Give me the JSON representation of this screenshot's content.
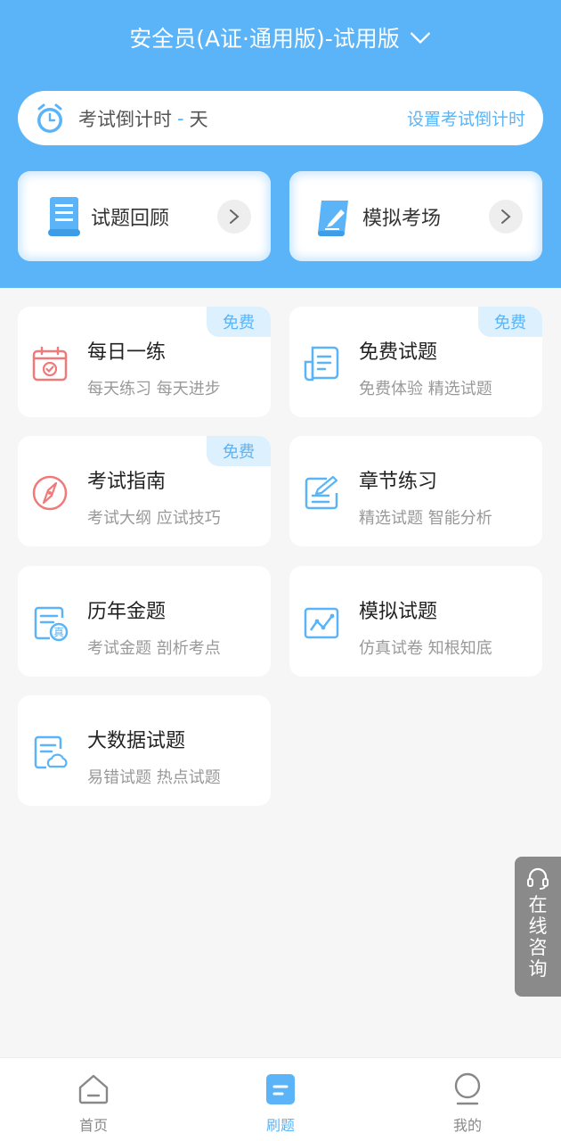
{
  "header": {
    "title": "安全员(A证·通用版)-试用版",
    "title_icon": "chevron-down-icon"
  },
  "countdown": {
    "label": "考试倒计时",
    "dash": "-",
    "value": "天",
    "link": "设置考试倒计时",
    "icon": "alarm-clock-icon"
  },
  "quick": [
    {
      "label": "试题回顾",
      "icon": "scroll-icon"
    },
    {
      "label": "模拟考场",
      "icon": "pen-paper-icon"
    }
  ],
  "cards": [
    {
      "title": "每日一练",
      "sub": "每天练习 每天进步",
      "badge": "免费",
      "icon": "calendar-check-icon"
    },
    {
      "title": "免费试题",
      "sub": "免费体验 精选试题",
      "badge": "免费",
      "icon": "document-icon"
    },
    {
      "title": "考试指南",
      "sub": "考试大纲 应试技巧",
      "badge": "免费",
      "icon": "compass-icon"
    },
    {
      "title": "章节练习",
      "sub": "精选试题 智能分析",
      "badge": "",
      "icon": "edit-list-icon"
    },
    {
      "title": "历年金题",
      "sub": "考试金题 剖析考点",
      "badge": "",
      "icon": "real-exam-icon"
    },
    {
      "title": "模拟试题",
      "sub": "仿真试卷 知根知底",
      "badge": "",
      "icon": "line-chart-icon"
    },
    {
      "title": "大数据试题",
      "sub": "易错试题 热点试题",
      "badge": "",
      "icon": "cloud-doc-icon"
    }
  ],
  "float": {
    "label": "在线咨询",
    "icon": "headset-icon"
  },
  "tabs": [
    {
      "label": "首页",
      "icon": "home-icon"
    },
    {
      "label": "刷题",
      "icon": "practice-icon"
    },
    {
      "label": "我的",
      "icon": "user-icon"
    }
  ],
  "colors": {
    "primary": "#5ab4f7",
    "badge_bg": "#ddf0fd",
    "float_bg": "#8a8a8a"
  }
}
